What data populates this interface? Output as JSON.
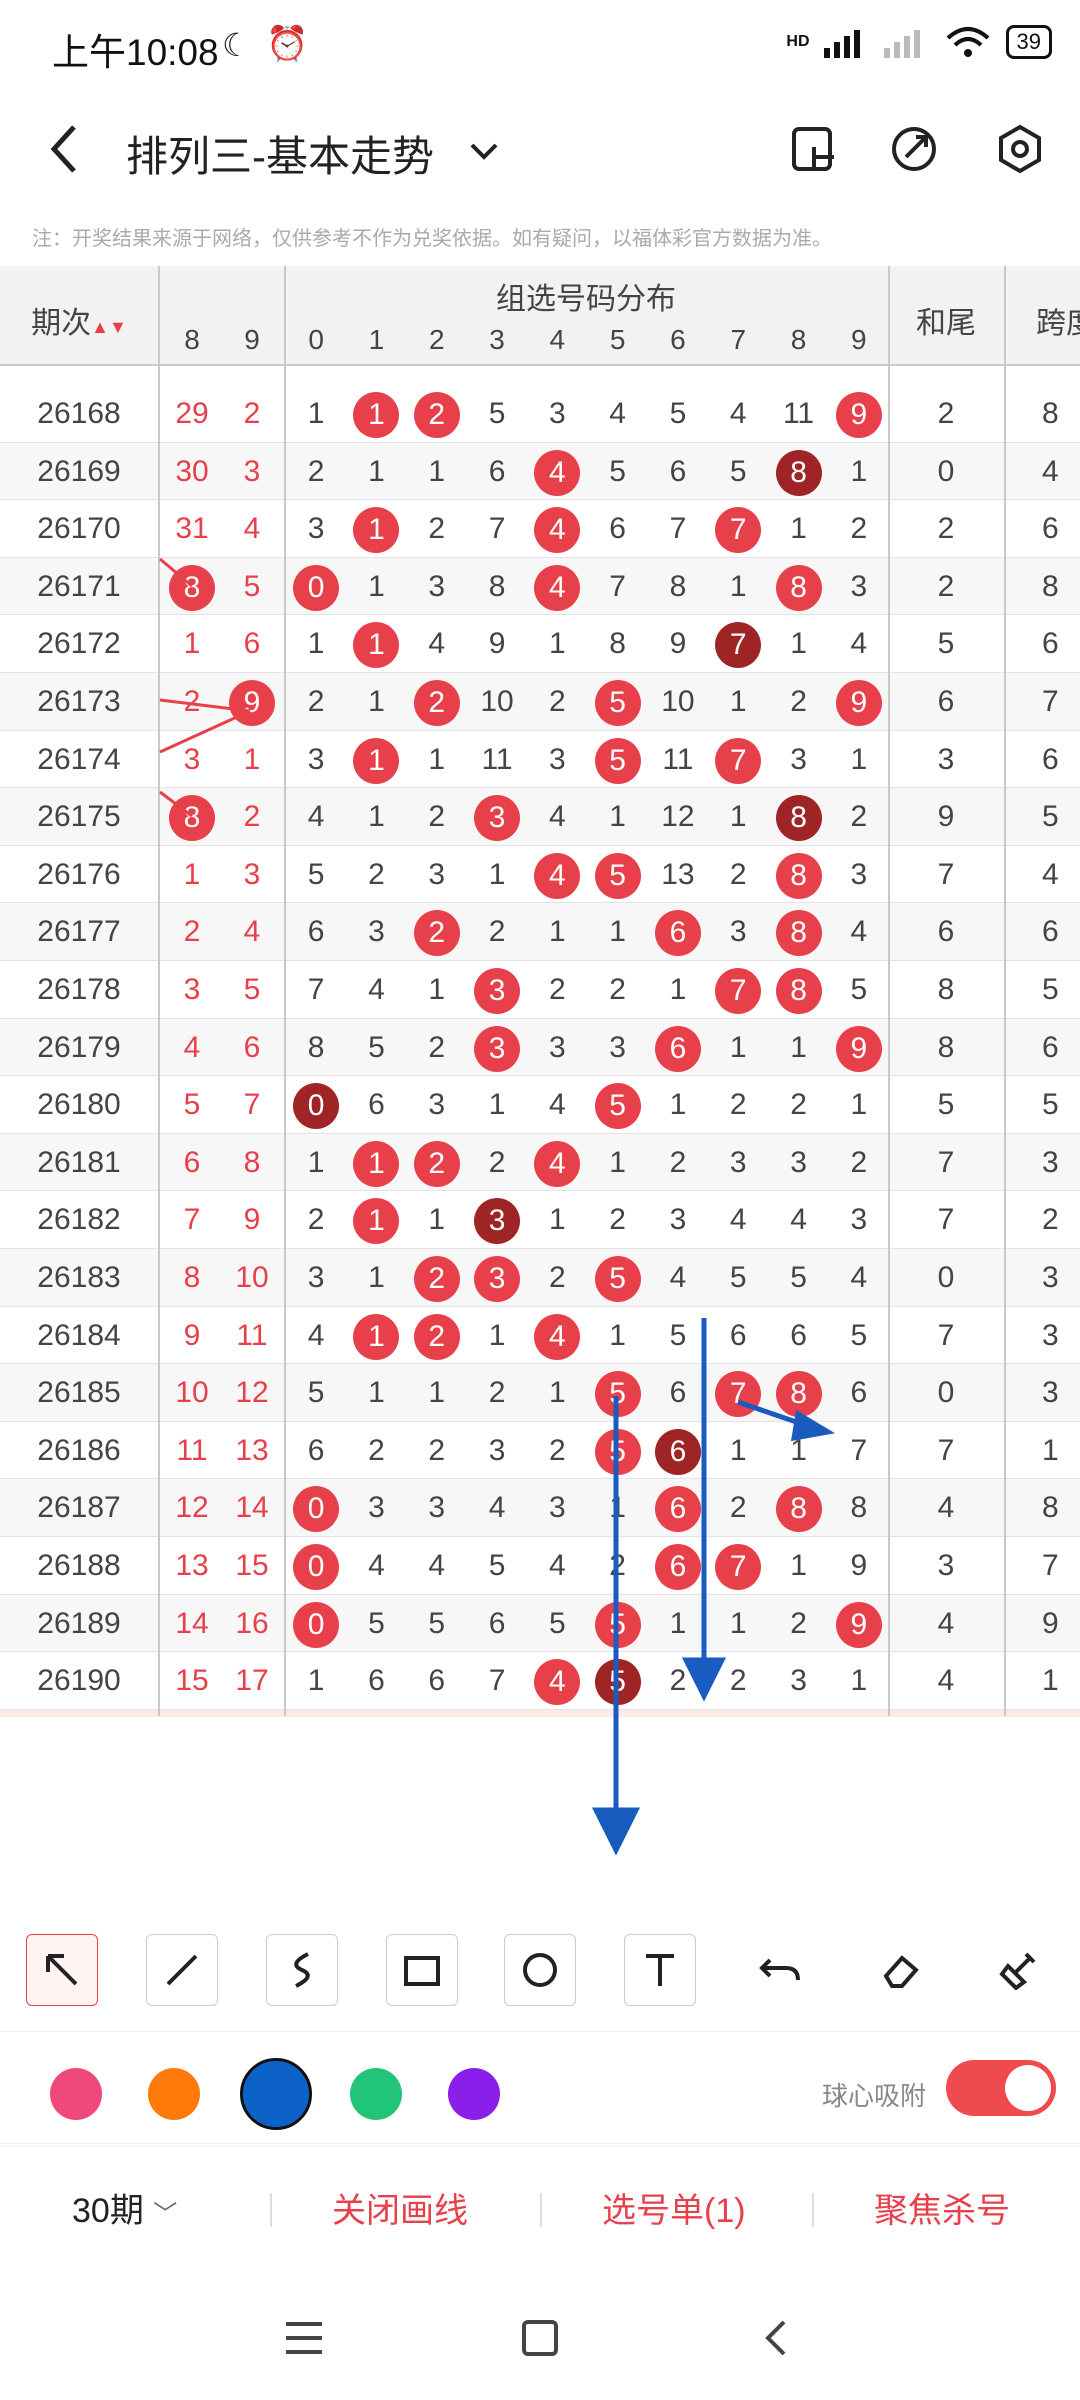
{
  "status_bar": {
    "time": "上午10:08",
    "battery": "39",
    "network": "HD"
  },
  "nav": {
    "title": "排列三-基本走势"
  },
  "note": "注：开奖结果来源于网络，仅供参考不作为兑奖依据。如有疑问，以福体彩官方数据为准。",
  "table": {
    "col_issue": "期次",
    "group_title": "组选号码分布",
    "col_sum_tail": "和尾",
    "col_span": "跨度",
    "left_digits": [
      "8",
      "9"
    ],
    "dist_digits": [
      "0",
      "1",
      "2",
      "3",
      "4",
      "5",
      "6",
      "7",
      "8",
      "9"
    ],
    "rows": [
      {
        "issue": "26168",
        "a": "29",
        "b": "2",
        "d": [
          "1",
          "1",
          "2",
          "5",
          "3",
          "4",
          "5",
          "4",
          "11",
          "9"
        ],
        "hit": [
          1,
          2,
          9
        ],
        "dark": [],
        "tail": "2",
        "span": "8"
      },
      {
        "issue": "26169",
        "a": "30",
        "b": "3",
        "d": [
          "2",
          "1",
          "1",
          "6",
          "4",
          "5",
          "6",
          "5",
          "8",
          "1"
        ],
        "hit": [
          4
        ],
        "dark": [
          8
        ],
        "tail": "0",
        "span": "4"
      },
      {
        "issue": "26170",
        "a": "31",
        "b": "4",
        "d": [
          "3",
          "1",
          "2",
          "7",
          "4",
          "6",
          "7",
          "7",
          "1",
          "2"
        ],
        "hit": [
          1,
          4,
          7
        ],
        "dark": [],
        "tail": "2",
        "span": "6"
      },
      {
        "issue": "26171",
        "a": "8",
        "b": "5",
        "d": [
          "0",
          "1",
          "3",
          "8",
          "4",
          "7",
          "8",
          "1",
          "8",
          "3"
        ],
        "hit": [
          0,
          4,
          8
        ],
        "dark": [],
        "ahit": true,
        "tail": "2",
        "span": "8"
      },
      {
        "issue": "26172",
        "a": "1",
        "b": "6",
        "d": [
          "1",
          "1",
          "4",
          "9",
          "1",
          "8",
          "9",
          "7",
          "1",
          "4"
        ],
        "hit": [
          1
        ],
        "dark": [
          7
        ],
        "tail": "5",
        "span": "6"
      },
      {
        "issue": "26173",
        "a": "2",
        "b": "9",
        "d": [
          "2",
          "1",
          "2",
          "10",
          "2",
          "5",
          "10",
          "1",
          "2",
          "9"
        ],
        "hit": [
          2,
          5,
          9
        ],
        "dark": [],
        "bhit": true,
        "tail": "6",
        "span": "7"
      },
      {
        "issue": "26174",
        "a": "3",
        "b": "1",
        "d": [
          "3",
          "1",
          "1",
          "11",
          "3",
          "5",
          "11",
          "7",
          "3",
          "1"
        ],
        "hit": [
          1,
          5,
          7
        ],
        "dark": [],
        "tail": "3",
        "span": "6"
      },
      {
        "issue": "26175",
        "a": "8",
        "b": "2",
        "d": [
          "4",
          "1",
          "2",
          "3",
          "4",
          "1",
          "12",
          "1",
          "8",
          "2"
        ],
        "hit": [
          3
        ],
        "dark": [
          8
        ],
        "ahit": true,
        "tail": "9",
        "span": "5"
      },
      {
        "issue": "26176",
        "a": "1",
        "b": "3",
        "d": [
          "5",
          "2",
          "3",
          "1",
          "4",
          "5",
          "13",
          "2",
          "8",
          "3"
        ],
        "hit": [
          4,
          5,
          8
        ],
        "dark": [],
        "tail": "7",
        "span": "4"
      },
      {
        "issue": "26177",
        "a": "2",
        "b": "4",
        "d": [
          "6",
          "3",
          "2",
          "2",
          "1",
          "1",
          "6",
          "3",
          "8",
          "4"
        ],
        "hit": [
          2,
          6,
          8
        ],
        "dark": [],
        "tail": "6",
        "span": "6"
      },
      {
        "issue": "26178",
        "a": "3",
        "b": "5",
        "d": [
          "7",
          "4",
          "1",
          "3",
          "2",
          "2",
          "1",
          "7",
          "8",
          "5"
        ],
        "hit": [
          3,
          7,
          8
        ],
        "dark": [],
        "tail": "8",
        "span": "5"
      },
      {
        "issue": "26179",
        "a": "4",
        "b": "6",
        "d": [
          "8",
          "5",
          "2",
          "3",
          "3",
          "3",
          "6",
          "1",
          "1",
          "9"
        ],
        "hit": [
          3,
          6,
          9
        ],
        "dark": [],
        "tail": "8",
        "span": "6"
      },
      {
        "issue": "26180",
        "a": "5",
        "b": "7",
        "d": [
          "0",
          "6",
          "3",
          "1",
          "4",
          "5",
          "1",
          "2",
          "2",
          "1"
        ],
        "hit": [
          5
        ],
        "dark": [
          0
        ],
        "tail": "5",
        "span": "5"
      },
      {
        "issue": "26181",
        "a": "6",
        "b": "8",
        "d": [
          "1",
          "1",
          "2",
          "2",
          "4",
          "1",
          "2",
          "3",
          "3",
          "2"
        ],
        "hit": [
          1,
          2,
          4
        ],
        "dark": [],
        "tail": "7",
        "span": "3"
      },
      {
        "issue": "26182",
        "a": "7",
        "b": "9",
        "d": [
          "2",
          "1",
          "1",
          "3",
          "1",
          "2",
          "3",
          "4",
          "4",
          "3"
        ],
        "hit": [
          1
        ],
        "dark": [
          3
        ],
        "tail": "7",
        "span": "2"
      },
      {
        "issue": "26183",
        "a": "8",
        "b": "10",
        "d": [
          "3",
          "1",
          "2",
          "3",
          "2",
          "5",
          "4",
          "5",
          "5",
          "4"
        ],
        "hit": [
          2,
          3,
          5
        ],
        "dark": [],
        "tail": "0",
        "span": "3"
      },
      {
        "issue": "26184",
        "a": "9",
        "b": "11",
        "d": [
          "4",
          "1",
          "2",
          "1",
          "4",
          "1",
          "5",
          "6",
          "6",
          "5"
        ],
        "hit": [
          1,
          2,
          4
        ],
        "dark": [],
        "tail": "7",
        "span": "3"
      },
      {
        "issue": "26185",
        "a": "10",
        "b": "12",
        "d": [
          "5",
          "1",
          "1",
          "2",
          "1",
          "5",
          "6",
          "7",
          "8",
          "6"
        ],
        "hit": [
          5,
          7,
          8
        ],
        "dark": [],
        "tail": "0",
        "span": "3"
      },
      {
        "issue": "26186",
        "a": "11",
        "b": "13",
        "d": [
          "6",
          "2",
          "2",
          "3",
          "2",
          "5",
          "6",
          "1",
          "1",
          "7"
        ],
        "hit": [
          5
        ],
        "dark": [
          6
        ],
        "tail": "7",
        "span": "1"
      },
      {
        "issue": "26187",
        "a": "12",
        "b": "14",
        "d": [
          "0",
          "3",
          "3",
          "4",
          "3",
          "1",
          "6",
          "2",
          "8",
          "8"
        ],
        "hit": [
          0,
          6,
          8
        ],
        "dark": [],
        "tail": "4",
        "span": "8"
      },
      {
        "issue": "26188",
        "a": "13",
        "b": "15",
        "d": [
          "0",
          "4",
          "4",
          "5",
          "4",
          "2",
          "6",
          "7",
          "1",
          "9"
        ],
        "hit": [
          0,
          6,
          7
        ],
        "dark": [],
        "tail": "3",
        "span": "7"
      },
      {
        "issue": "26189",
        "a": "14",
        "b": "16",
        "d": [
          "0",
          "5",
          "5",
          "6",
          "5",
          "5",
          "1",
          "1",
          "2",
          "9"
        ],
        "hit": [
          0,
          5,
          9
        ],
        "dark": [],
        "tail": "4",
        "span": "9"
      },
      {
        "issue": "26190",
        "a": "15",
        "b": "17",
        "d": [
          "1",
          "6",
          "6",
          "7",
          "4",
          "5",
          "2",
          "2",
          "3",
          "1"
        ],
        "hit": [
          4
        ],
        "dark": [
          5
        ],
        "tail": "4",
        "span": "1"
      }
    ],
    "select_label": "选号",
    "select_rows": 3
  },
  "toolbar": {
    "tools": [
      "arrow-tool",
      "line-tool",
      "curve-tool",
      "rect-tool",
      "circle-tool",
      "text-tool",
      "undo-tool",
      "eraser-tool",
      "clear-tool"
    ]
  },
  "palette": {
    "colors": [
      "#f0487a",
      "#ff7a0a",
      "#0c62c8",
      "#22c47a",
      "#8b1ee8"
    ],
    "selected": 2,
    "snap_label": "球心吸附",
    "snap_on": true
  },
  "bottom_bar": {
    "period": "30期",
    "close_draw": "关闭画线",
    "selection": "选号单(1)",
    "focus_kill": "聚焦杀号"
  }
}
